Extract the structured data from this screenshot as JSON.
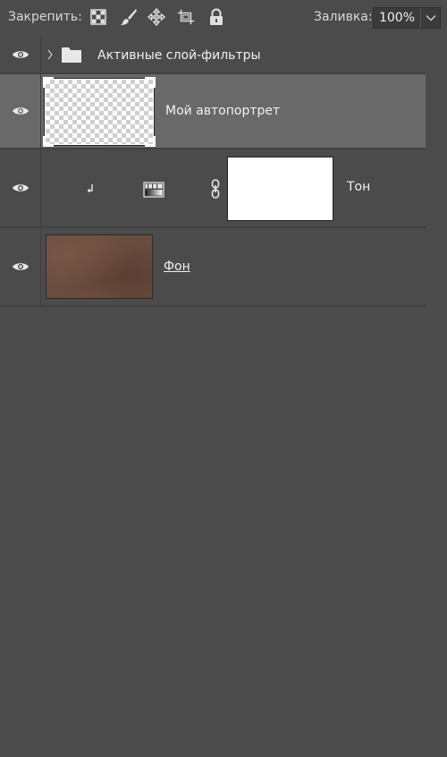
{
  "toolbar": {
    "lock_label": "Закрепить:",
    "lock_icons": [
      "lock-transparent-pixels-icon",
      "lock-image-pixels-icon",
      "lock-position-icon",
      "artboard-autonest-icon",
      "lock-all-icon"
    ],
    "fill_label": "Заливка:",
    "fill_value": "100%"
  },
  "layers": [
    {
      "type": "group",
      "name": "Активные слой-фильтры",
      "visible": true,
      "expanded": false
    },
    {
      "type": "pixel",
      "name": "Мой автопортрет",
      "visible": true,
      "selected": true,
      "thumbnail": "transparent"
    },
    {
      "type": "adjustment",
      "name": "Тон",
      "visible": true,
      "clipped": true,
      "adjustment_icon": "gradient-map-icon",
      "mask": "white"
    },
    {
      "type": "background",
      "name": "Фон",
      "visible": true,
      "thumbnail_color": "#6a4c40"
    }
  ],
  "colors": {
    "panel_bg": "#4b4b4b",
    "selected_row_bg": "#696969",
    "text": "#f0f0f0"
  }
}
